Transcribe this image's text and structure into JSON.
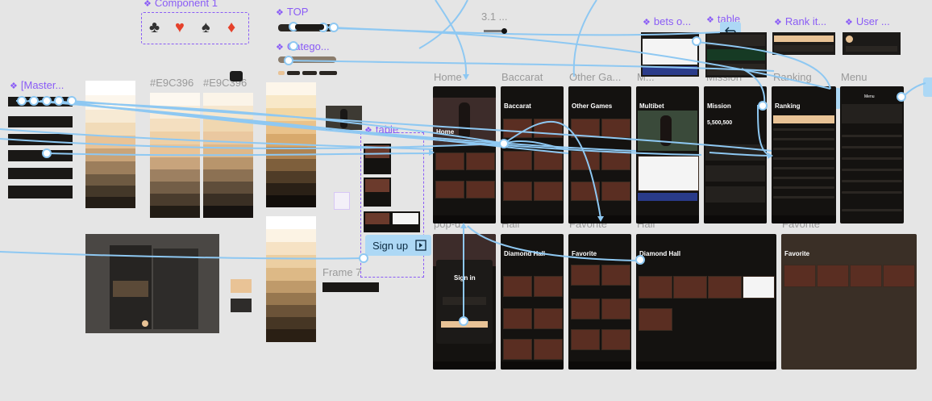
{
  "components": {
    "component1": "Component 1",
    "top": "TOP",
    "category": "Catego...",
    "master": "[Master...",
    "bets": "bets o...",
    "table_comp": "table",
    "rank": "Rank it...",
    "user": "User ...",
    "table_small": "table"
  },
  "labels": {
    "v31": "3.1 ...",
    "hex1": "#E9C396",
    "hex2": "#E9C396",
    "home": "Home",
    "baccarat": "Baccarat",
    "other_games": "Other Ga...",
    "m": "M...",
    "mission": "Mission",
    "ranking": "Ranking",
    "menu": "Menu",
    "popup": "pop-u...",
    "hall1": "Hall",
    "favorite1": "Favorite",
    "hall2": "Hall",
    "favorite2": "Favorite",
    "frame": "Frame 7"
  },
  "screens": {
    "home_title": "Home",
    "baccarat_title": "Baccarat",
    "other_title": "Other Games",
    "multibet_title": "Multibet",
    "mission_title": "Mission",
    "mission_points": "5,500,500",
    "ranking_title": "Ranking",
    "menu_title": "Menu",
    "signin_title": "Sign in",
    "diamond_title": "Diamond Hall",
    "favorite_title": "Favorite",
    "diamond_title2": "Diamond Hall",
    "favorite_title2": "Favorite"
  },
  "prototype": {
    "signup_label": "Sign up"
  },
  "suits": [
    "♣",
    "♥",
    "♠",
    "♦"
  ],
  "colors": {
    "accent": "#8a5cf6",
    "connector": "#8ec8f2",
    "gold": "#E9C396",
    "dark": "#141210"
  },
  "icons": [
    "club-icon",
    "heart-icon",
    "spade-icon",
    "diamond-icon",
    "back-arrow-icon",
    "add-frame-icon",
    "play-frame-icon"
  ]
}
